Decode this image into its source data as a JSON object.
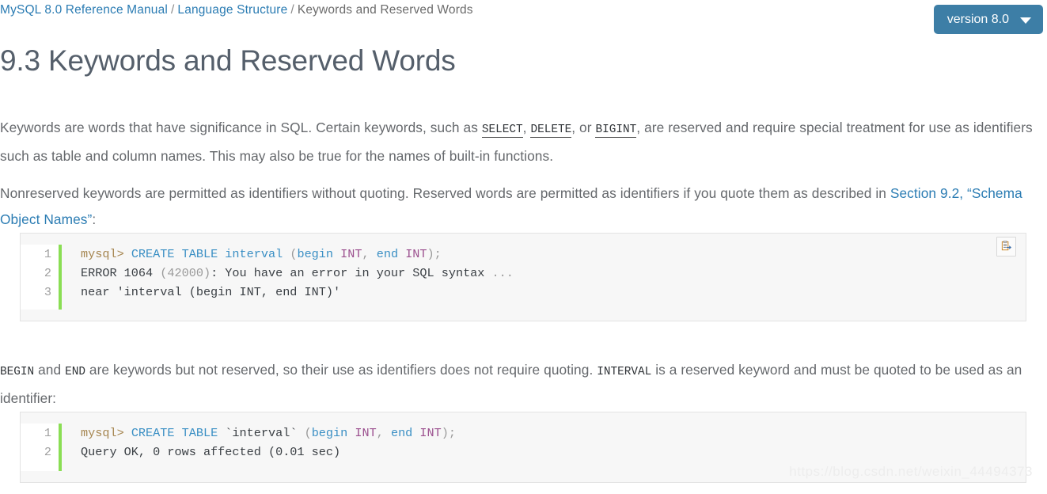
{
  "breadcrumb": {
    "items": [
      {
        "label": "MySQL 8.0 Reference Manual",
        "link": true
      },
      {
        "label": "Language Structure",
        "link": true
      },
      {
        "label": "Keywords and Reserved Words",
        "link": false
      }
    ],
    "separator": "/"
  },
  "version_button": {
    "label": "version 8.0",
    "icon": "chevron-down-icon",
    "background": "#3d7ea6",
    "text_color": "#ffffff"
  },
  "page_title": "9.3 Keywords and Reserved Words",
  "paragraphs": {
    "intro": {
      "part1": "Keywords are words that have significance in SQL. Certain keywords, such as ",
      "kw1": "SELECT",
      "sep1": ", ",
      "kw2": "DELETE",
      "sep2": ", or ",
      "kw3": "BIGINT",
      "part2": ", are reserved and require special treatment for use as identifiers such as table and column names. This may also be true for the names of built-in functions."
    },
    "nonreserved": {
      "part1": "Nonreserved keywords are permitted as identifiers without quoting. Reserved words are permitted as identifiers if you quote them as described in ",
      "link": "Section 9.2, “Schema Object Names”",
      "part2": ":"
    },
    "begin_end": {
      "kw1": "BEGIN",
      "part1": " and ",
      "kw2": "END",
      "part2": " are keywords but not reserved, so their use as identifiers does not require quoting. ",
      "kw3": "INTERVAL",
      "part3": " is a reserved keyword and must be quoted to be used as an identifier:"
    }
  },
  "code_blocks": [
    {
      "id": "code-1",
      "copy_icon": "clipboard-copy-icon",
      "line_numbers": [
        "1",
        "2",
        "3"
      ],
      "lines": [
        [
          {
            "text": "mysql> ",
            "cls": "t-prompt"
          },
          {
            "text": "CREATE TABLE interval ",
            "cls": "t-kw"
          },
          {
            "text": "(",
            "cls": "t-punc"
          },
          {
            "text": "begin ",
            "cls": "t-kw"
          },
          {
            "text": "INT",
            "cls": "t-type"
          },
          {
            "text": ", ",
            "cls": "t-punc"
          },
          {
            "text": "end ",
            "cls": "t-kw"
          },
          {
            "text": "INT",
            "cls": "t-type"
          },
          {
            "text": ");",
            "cls": "t-punc"
          }
        ],
        [
          {
            "text": "ERROR 1064 ",
            "cls": "t-plain"
          },
          {
            "text": "(42000)",
            "cls": "t-punc"
          },
          {
            "text": ": You have an error in your SQL syntax ",
            "cls": "t-plain"
          },
          {
            "text": "...",
            "cls": "t-punc"
          }
        ],
        [
          {
            "text": "near 'interval (begin INT, end INT)'",
            "cls": "t-plain"
          }
        ]
      ]
    },
    {
      "id": "code-2",
      "copy_icon": null,
      "line_numbers": [
        "1",
        "2"
      ],
      "lines": [
        [
          {
            "text": "mysql> ",
            "cls": "t-prompt"
          },
          {
            "text": "CREATE TABLE ",
            "cls": "t-kw"
          },
          {
            "text": "`interval` ",
            "cls": "t-plain"
          },
          {
            "text": "(",
            "cls": "t-punc"
          },
          {
            "text": "begin ",
            "cls": "t-kw"
          },
          {
            "text": "INT",
            "cls": "t-type"
          },
          {
            "text": ", ",
            "cls": "t-punc"
          },
          {
            "text": "end ",
            "cls": "t-kw"
          },
          {
            "text": "INT",
            "cls": "t-type"
          },
          {
            "text": ");",
            "cls": "t-punc"
          }
        ],
        [
          {
            "text": "Query OK, 0 rows affected (0.01 sec)",
            "cls": "t-plain"
          }
        ]
      ]
    }
  ],
  "watermark": "https://blog.csdn.net/weixin_44494373"
}
